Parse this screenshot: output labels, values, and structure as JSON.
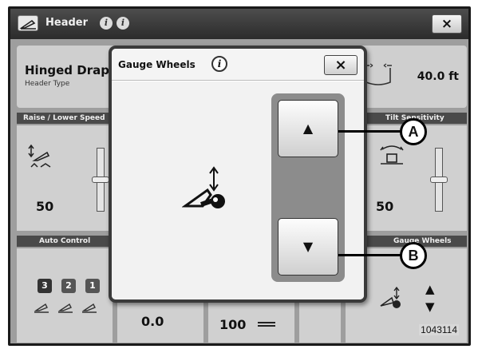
{
  "window": {
    "title": "Header",
    "close_label": "×"
  },
  "header_type": {
    "name": "Hinged Drape",
    "sublabel": "Header Type"
  },
  "header_width": {
    "value": "40.0 ft"
  },
  "sections": {
    "raise_lower_speed": "Raise / Lower Speed",
    "tilt_sensitivity": "Tilt Sensitivity",
    "auto_control": "Auto Control",
    "gauge_wheels": "Gauge Wheels"
  },
  "values": {
    "raise_lower": "50",
    "tilt": "50",
    "bottom_left": "0.0",
    "bottom_mid": "100"
  },
  "auto_control_badges": [
    "3",
    "2",
    "1"
  ],
  "dialog": {
    "title": "Gauge Wheels",
    "info_label": "i",
    "close_label": "×",
    "up_label": "▲",
    "down_label": "▼"
  },
  "callouts": {
    "a": "A",
    "b": "B"
  },
  "figure_number": "1043114",
  "icons": {
    "header": "header-icon",
    "info": "info-icon",
    "close": "close-icon",
    "gauge_wheel": "gauge-wheel-icon",
    "up_arrow": "arrow-up-icon",
    "down_arrow": "arrow-down-icon"
  }
}
